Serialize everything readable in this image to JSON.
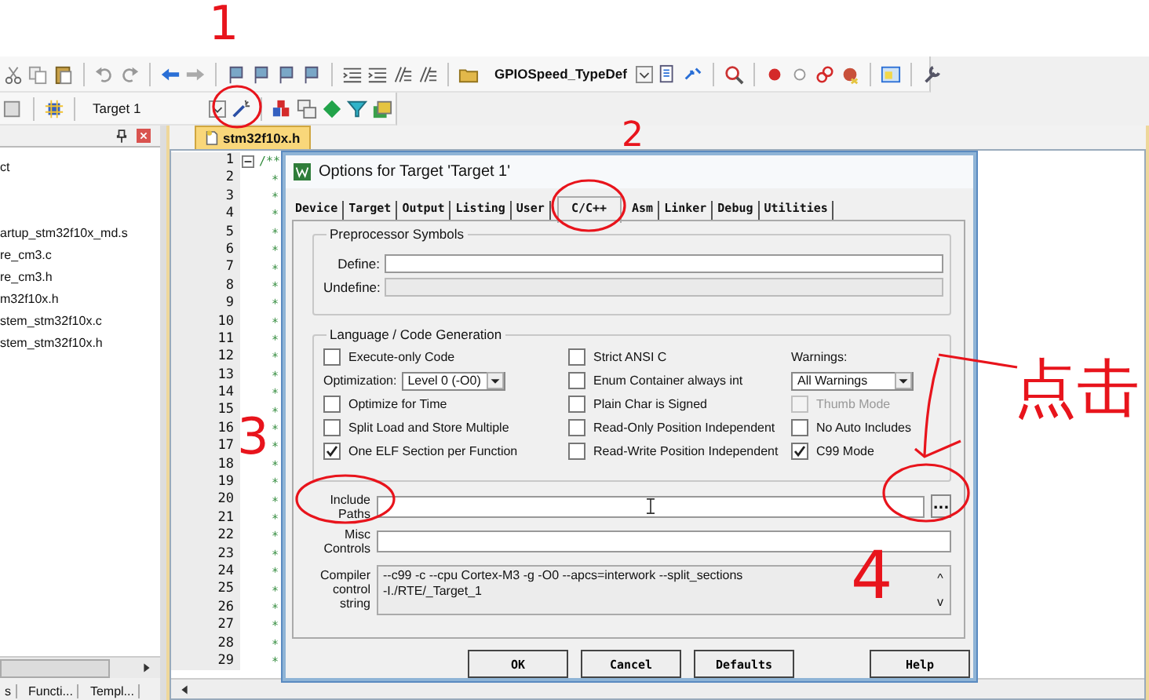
{
  "toolbar": {
    "symbol_combo": "GPIOSpeed_TypeDef"
  },
  "build_toolbar": {
    "target_combo": "Target 1"
  },
  "project_panel": {
    "items": [
      "ct",
      "artup_stm32f10x_md.s",
      "re_cm3.c",
      "re_cm3.h",
      "m32f10x.h",
      "stem_stm32f10x.c",
      "stem_stm32f10x.h"
    ],
    "tabs": [
      {
        "label": "s",
        "selected": false
      },
      {
        "label": "Functi...",
        "selected": false
      },
      {
        "label": "Templ...",
        "selected": false
      }
    ]
  },
  "editor": {
    "tab": "stm32f10x.h",
    "lines": [
      {
        "number": "1",
        "text": "/**"
      },
      {
        "number": "2",
        "text": "*"
      },
      {
        "number": "3",
        "text": "*"
      },
      {
        "number": "4",
        "text": "*"
      },
      {
        "number": "5",
        "text": "*"
      },
      {
        "number": "6",
        "text": "*"
      },
      {
        "number": "7",
        "text": "*"
      },
      {
        "number": "8",
        "text": "*"
      },
      {
        "number": "9",
        "text": "*"
      },
      {
        "number": "10",
        "text": "*"
      },
      {
        "number": "11",
        "text": "*"
      },
      {
        "number": "12",
        "text": "*"
      },
      {
        "number": "13",
        "text": "*"
      },
      {
        "number": "14",
        "text": "*"
      },
      {
        "number": "15",
        "text": "*"
      },
      {
        "number": "16",
        "text": "*"
      },
      {
        "number": "17",
        "text": "*"
      },
      {
        "number": "18",
        "text": "*"
      },
      {
        "number": "19",
        "text": "*"
      },
      {
        "number": "20",
        "text": "*"
      },
      {
        "number": "21",
        "text": "*"
      },
      {
        "number": "22",
        "text": "*"
      },
      {
        "number": "23",
        "text": "*"
      },
      {
        "number": "24",
        "text": "*"
      },
      {
        "number": "25",
        "text": "*"
      },
      {
        "number": "26",
        "text": "*"
      },
      {
        "number": "27",
        "text": "*"
      },
      {
        "number": "28",
        "text": "*"
      },
      {
        "number": "29",
        "text": "*"
      }
    ]
  },
  "dialog": {
    "title": "Options for Target 'Target 1'",
    "tabs": [
      {
        "label": "Device",
        "selected": false
      },
      {
        "label": "Target",
        "selected": false
      },
      {
        "label": "Output",
        "selected": false
      },
      {
        "label": "Listing",
        "selected": false
      },
      {
        "label": "User",
        "selected": false
      },
      {
        "label": "C/C++",
        "selected": true
      },
      {
        "label": "Asm",
        "selected": false
      },
      {
        "label": "Linker",
        "selected": false
      },
      {
        "label": "Debug",
        "selected": false
      },
      {
        "label": "Utilities",
        "selected": false
      }
    ],
    "preprocessor": {
      "title": "Preprocessor Symbols",
      "fields": [
        {
          "label": "Define:",
          "disabled": false
        },
        {
          "label": "Undefine:",
          "disabled": true
        }
      ]
    },
    "language": {
      "title": "Language / Code Generation",
      "columns": [
        [
          {
            "kind": "checkbox",
            "label": "Execute-only Code",
            "checked": false,
            "disabled": false
          },
          {
            "kind": "select",
            "label": "Optimization:",
            "value": "Level 0 (-O0)"
          },
          {
            "kind": "checkbox",
            "label": "Optimize for Time",
            "checked": false,
            "disabled": false
          },
          {
            "kind": "checkbox",
            "label": "Split Load and Store Multiple",
            "checked": false,
            "disabled": false
          },
          {
            "kind": "checkbox",
            "label": "One ELF Section per Function",
            "checked": true,
            "disabled": false
          }
        ],
        [
          {
            "kind": "checkbox",
            "label": "Strict ANSI C",
            "checked": false,
            "disabled": false
          },
          {
            "kind": "checkbox",
            "label": "Enum Container always int",
            "checked": false,
            "disabled": false
          },
          {
            "kind": "checkbox",
            "label": "Plain Char is Signed",
            "checked": false,
            "disabled": false
          },
          {
            "kind": "checkbox",
            "label": "Read-Only Position Independent",
            "checked": false,
            "disabled": false
          },
          {
            "kind": "checkbox",
            "label": "Read-Write Position Independent",
            "checked": false,
            "disabled": false
          }
        ],
        [
          {
            "kind": "caption",
            "label": "Warnings:"
          },
          {
            "kind": "select",
            "value": "All Warnings"
          },
          {
            "kind": "checkbox",
            "label": "Thumb Mode",
            "checked": false,
            "disabled": true
          },
          {
            "kind": "checkbox",
            "label": "No Auto Includes",
            "checked": false,
            "disabled": false
          },
          {
            "kind": "checkbox",
            "label": "C99 Mode",
            "checked": true,
            "disabled": false
          }
        ]
      ]
    },
    "include_paths": {
      "label": "Include Paths",
      "browse": "..."
    },
    "misc_controls": {
      "label": "Misc Controls"
    },
    "compiler_string": {
      "label": "Compiler control string",
      "lines": [
        "--c99 -c --cpu Cortex-M3 -g -O0 --apcs=interwork --split_sections",
        "-I./RTE/_Target_1"
      ],
      "scroll_up": "^",
      "scroll_down": "v"
    },
    "buttons": [
      "OK",
      "Cancel",
      "Defaults",
      "Help"
    ]
  },
  "annotations": [
    "1",
    "2",
    "3",
    "4",
    "点击"
  ]
}
